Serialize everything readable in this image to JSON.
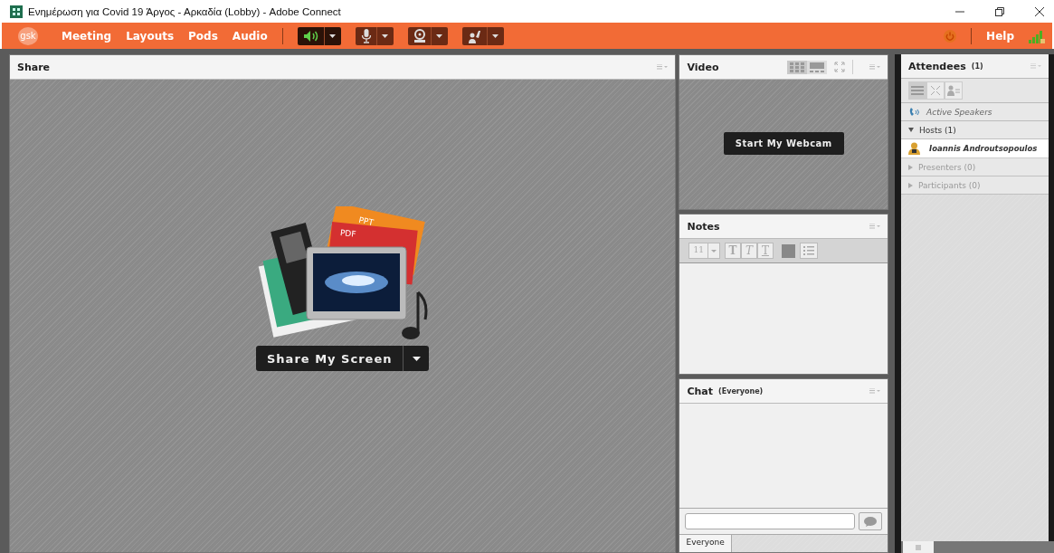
{
  "window": {
    "title": "Ενημέρωση για Covid 19 Άργος - Αρκαδία (Lobby) - Adobe Connect"
  },
  "menubar": {
    "logo": "gsk",
    "menus": [
      "Meeting",
      "Layouts",
      "Pods",
      "Audio"
    ],
    "media_buttons": [
      {
        "kind": "speaker",
        "on": true
      },
      {
        "kind": "microphone",
        "on": false
      },
      {
        "kind": "webcam",
        "on": false
      },
      {
        "kind": "hand",
        "on": false
      }
    ],
    "help": "Help"
  },
  "share_pod": {
    "title": "Share",
    "artwork_labels": [
      "PPT",
      "PDF"
    ],
    "share_button": "Share My Screen"
  },
  "video_pod": {
    "title": "Video",
    "views": [
      {
        "kind": "grid",
        "selected": true
      },
      {
        "kind": "filmstrip",
        "selected": false
      }
    ],
    "start_button": "Start My Webcam"
  },
  "notes_pod": {
    "title": "Notes",
    "font_size": "11",
    "format_buttons": [
      {
        "kind": "bold",
        "label": "T"
      },
      {
        "kind": "italic",
        "label": "T"
      },
      {
        "kind": "underline",
        "label": "T"
      }
    ]
  },
  "chat_pod": {
    "title": "Chat",
    "audience": "(Everyone)",
    "tabs": [
      {
        "label": "Everyone",
        "selected": true
      }
    ]
  },
  "attendees_pod": {
    "title": "Attendees",
    "count": "(1)",
    "views": [
      {
        "kind": "list",
        "selected": true
      },
      {
        "kind": "breakout",
        "selected": false
      },
      {
        "kind": "status",
        "selected": false
      }
    ],
    "active_speakers": "Active Speakers",
    "groups": [
      {
        "label": "Hosts (1)",
        "expanded": true,
        "children": [
          {
            "name": "Ioannis Androutsopoulos"
          }
        ]
      },
      {
        "label": "Presenters (0)",
        "expanded": false
      },
      {
        "label": "Participants (0)",
        "expanded": false
      }
    ]
  }
}
